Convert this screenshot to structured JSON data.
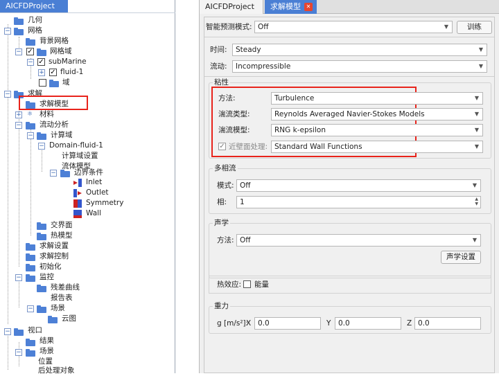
{
  "left_tab": "AICFDProject",
  "tree": {
    "geometry": "几何",
    "mesh": "网格",
    "bg_mesh": "背景网格",
    "mesh_domain": "网格域",
    "submarine": "subMarine",
    "fluid1": "fluid-1",
    "domain": "域",
    "solve": "求解",
    "solver_model": "求解模型",
    "material": "材料",
    "flow_analysis": "流动分析",
    "compute_domain": "计算域",
    "domain_fluid1": "Domain-fluid-1",
    "compute_domain_settings": "计算域设置",
    "fluid_model": "流体模型",
    "boundary_conditions": "边界条件",
    "inlet": "Inlet",
    "outlet": "Outlet",
    "symmetry": "Symmetry",
    "wall": "Wall",
    "interface": "交界面",
    "thermal_model": "热模型",
    "solve_settings": "求解设置",
    "solve_control": "求解控制",
    "initialize": "初始化",
    "monitor": "监控",
    "residual_curve": "残差曲线",
    "report_table": "报告表",
    "scene": "场景",
    "contour": "云图",
    "viewport": "视口",
    "result": "结果",
    "scene2": "场景",
    "position": "位置",
    "postprocess_object": "后处理对象"
  },
  "right_tabs": {
    "project": "AICFDProject",
    "solver": "求解模型",
    "close": "✕"
  },
  "smart": {
    "label": "智能预测模式:",
    "value": "Off",
    "train": "训练"
  },
  "time": {
    "label": "时间:",
    "value": "Steady"
  },
  "flow": {
    "label": "流动:",
    "value": "Incompressible"
  },
  "viscosity": {
    "title": "粘性",
    "method_label": "方法:",
    "method_value": "Turbulence",
    "turb_type_label": "湍流类型:",
    "turb_type_value": "Reynolds Averaged Navier-Stokes Models",
    "turb_model_label": "湍流模型:",
    "turb_model_value": "RNG k-epsilon",
    "wall_label": "近壁面处理:",
    "wall_value": "Standard Wall Functions"
  },
  "multiphase": {
    "title": "多相流",
    "mode_label": "模式:",
    "mode_value": "Off",
    "phase_label": "相:",
    "phase_value": "1"
  },
  "acoustics": {
    "title": "声学",
    "method_label": "方法:",
    "method_value": "Off",
    "settings_button": "声学设置"
  },
  "thermal": {
    "label": "热效应:",
    "energy": "能量"
  },
  "gravity": {
    "title": "重力",
    "g_label": "g [m/s²]:",
    "x_label": "X",
    "x_value": "0.0",
    "y_label": "Y",
    "y_value": "0.0",
    "z_label": "Z",
    "z_value": "0.0"
  },
  "colors": {
    "highlight": "#e8231b",
    "tab_active": "#4a7fd4",
    "folder": "#4d80d6"
  }
}
